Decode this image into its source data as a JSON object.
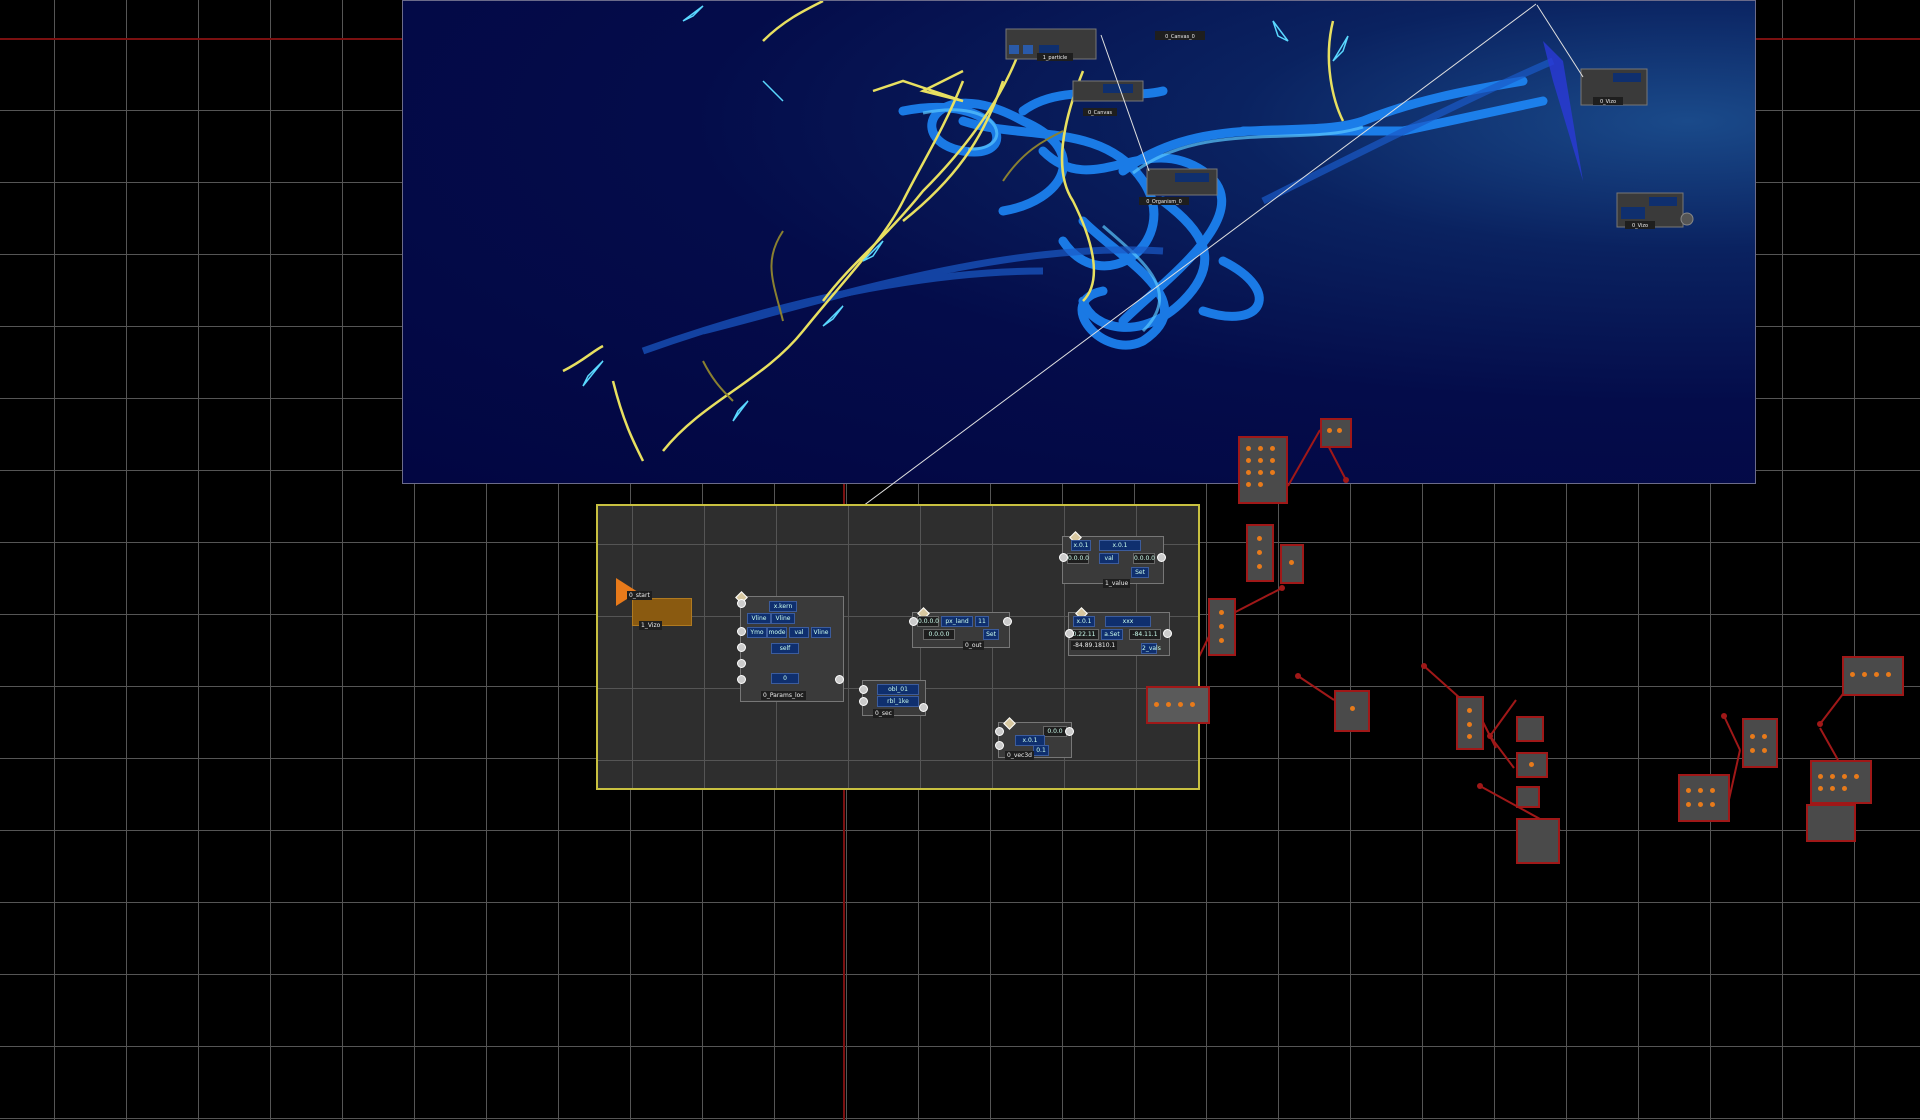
{
  "canvas": {
    "background": "#000000",
    "grid_color": "#555555",
    "axis_color": "#7a1010"
  },
  "preview": {
    "name": "render-preview"
  },
  "group": {
    "border_color": "#c8c040",
    "nodes": {
      "start": {
        "title": "0_start",
        "value": "1_Vizo"
      },
      "emitter": {
        "port_values": [
          "0",
          "1"
        ],
        "fields": [
          "x.kern",
          "Vline",
          "Vline",
          "Ymo",
          "mode",
          "val",
          "Vline",
          "self",
          "0"
        ],
        "caption": "0_Params_loc"
      },
      "mixer": {
        "fields": [
          "obl_01",
          "rbl_1ke"
        ],
        "caption": "0_sec"
      },
      "math": {
        "values": [
          "0.0.0.0",
          "px_land",
          "11",
          "0.0.0.0",
          "Set"
        ],
        "caption": "0_out"
      },
      "vector_a": {
        "values": [
          "x.0.1",
          "x.0.1",
          "0.0.0.0",
          "val",
          "0.0.0.0",
          "Set"
        ],
        "caption": "1_value"
      },
      "vector_b": {
        "values": [
          "x.0.1",
          "xxx",
          "0.22.11",
          "a.Set",
          "-84.11.1",
          "-84.89.1810.1"
        ],
        "caption": "2_vals"
      },
      "output": {
        "values": [
          "0.0.0",
          "x.0.1",
          "0.1"
        ],
        "caption": "0_vec3d"
      }
    }
  },
  "preview_nodes": {
    "top_node": {
      "caption": "1_particle"
    },
    "label_a": "0_Canvas_0",
    "label_b": "0_Canvas",
    "label_c": "0_Organism_0",
    "right_a": "0_Vizo",
    "right_b": "0_Vizo"
  },
  "colors": {
    "node_bg": "#3a3a3a",
    "field_bg": "#0f2f6e",
    "red_node_border": "#a01818",
    "red_node_dot": "#e87a1a",
    "streak_blue": "#1e8cff",
    "streak_yellow": "#e8e060"
  }
}
